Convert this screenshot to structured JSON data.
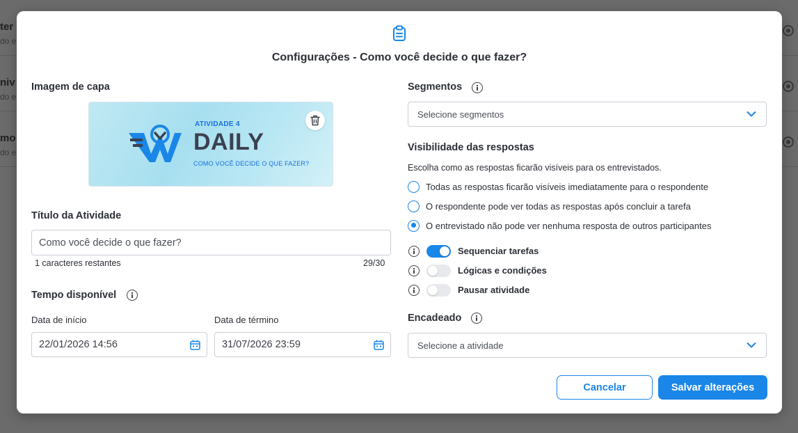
{
  "background": {
    "rows": [
      {
        "title": "ter",
        "subtitle": "do e"
      },
      {
        "title": "niv",
        "subtitle": "do e"
      },
      {
        "title": "mo c",
        "subtitle": "do e"
      }
    ]
  },
  "modal": {
    "title": "Configurações - Como você decide o que fazer?",
    "icon": "clipboard-icon"
  },
  "cover": {
    "label": "Imagem de capa",
    "kicker": "ATIVIDADE 4",
    "brand": "DAILY",
    "subtitle": "COMO VOCÊ DECIDE O QUE FAZER?"
  },
  "activity_title": {
    "label": "Título da Atividade",
    "value": "Como você decide o que fazer?",
    "remaining": "1 caracteres restantes",
    "counter": "29/30"
  },
  "time": {
    "label": "Tempo disponível",
    "start_label": "Data de início",
    "start_value": "22/01/2026 14:56",
    "end_label": "Data de término",
    "end_value": "31/07/2026 23:59"
  },
  "segments": {
    "label": "Segmentos",
    "placeholder": "Selecione segmentos"
  },
  "visibility": {
    "label": "Visibilidade das respostas",
    "help": "Escolha como as respostas ficarão visíveis para os entrevistados.",
    "options": [
      {
        "label": "Todas as respostas ficarão visíveis imediatamente para o respondente",
        "checked": false
      },
      {
        "label": "O respondente pode ver todas as respostas após concluir a tarefa",
        "checked": false
      },
      {
        "label": "O entrevistado não pode ver nenhuma resposta de outros participantes",
        "checked": true
      }
    ]
  },
  "toggles": [
    {
      "label": "Sequenciar tarefas",
      "on": true
    },
    {
      "label": "Lógicas e condições",
      "on": false
    },
    {
      "label": "Pausar atividade",
      "on": false
    }
  ],
  "chained": {
    "label": "Encadeado",
    "placeholder": "Selecione a atividade"
  },
  "buttons": {
    "cancel": "Cancelar",
    "save": "Salvar alterações"
  },
  "colors": {
    "accent": "#1a86e8",
    "overlay": "#6b6b6b"
  }
}
